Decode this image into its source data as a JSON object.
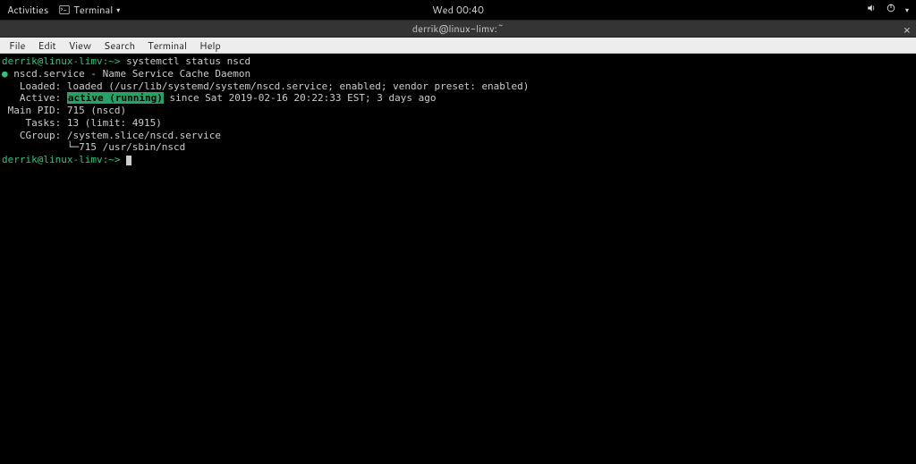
{
  "topbar": {
    "activities": "Activities",
    "app_name": "Terminal",
    "clock": "Wed 00:40"
  },
  "window": {
    "title": "derrik@linux-limv:~"
  },
  "menubar": {
    "file": "File",
    "edit": "Edit",
    "view": "View",
    "search": "Search",
    "terminal": "Terminal",
    "help": "Help"
  },
  "term": {
    "prompt1": "derrik@linux-limv:~>",
    "cmd1": " systemctl status nscd",
    "bullet": "●",
    "svc_line": " nscd.service - Name Service Cache Daemon",
    "loaded_label": "   Loaded: ",
    "loaded_val": "loaded (/usr/lib/systemd/system/nscd.service; enabled; vendor preset: enabled)",
    "active_label": "   Active: ",
    "active_val": "active (running)",
    "active_rest": " since Sat 2019-02-16 20:22:33 EST; 3 days ago",
    "mainpid_label": " Main PID: ",
    "mainpid_val": "715 (nscd)",
    "tasks_label": "    Tasks: ",
    "tasks_val": "13 (limit: 4915)",
    "cgroup_label": "   CGroup: ",
    "cgroup_val": "/system.slice/nscd.service",
    "cgroup_tree": "           └─715 /usr/sbin/nscd",
    "prompt2": "derrik@linux-limv:~> "
  }
}
